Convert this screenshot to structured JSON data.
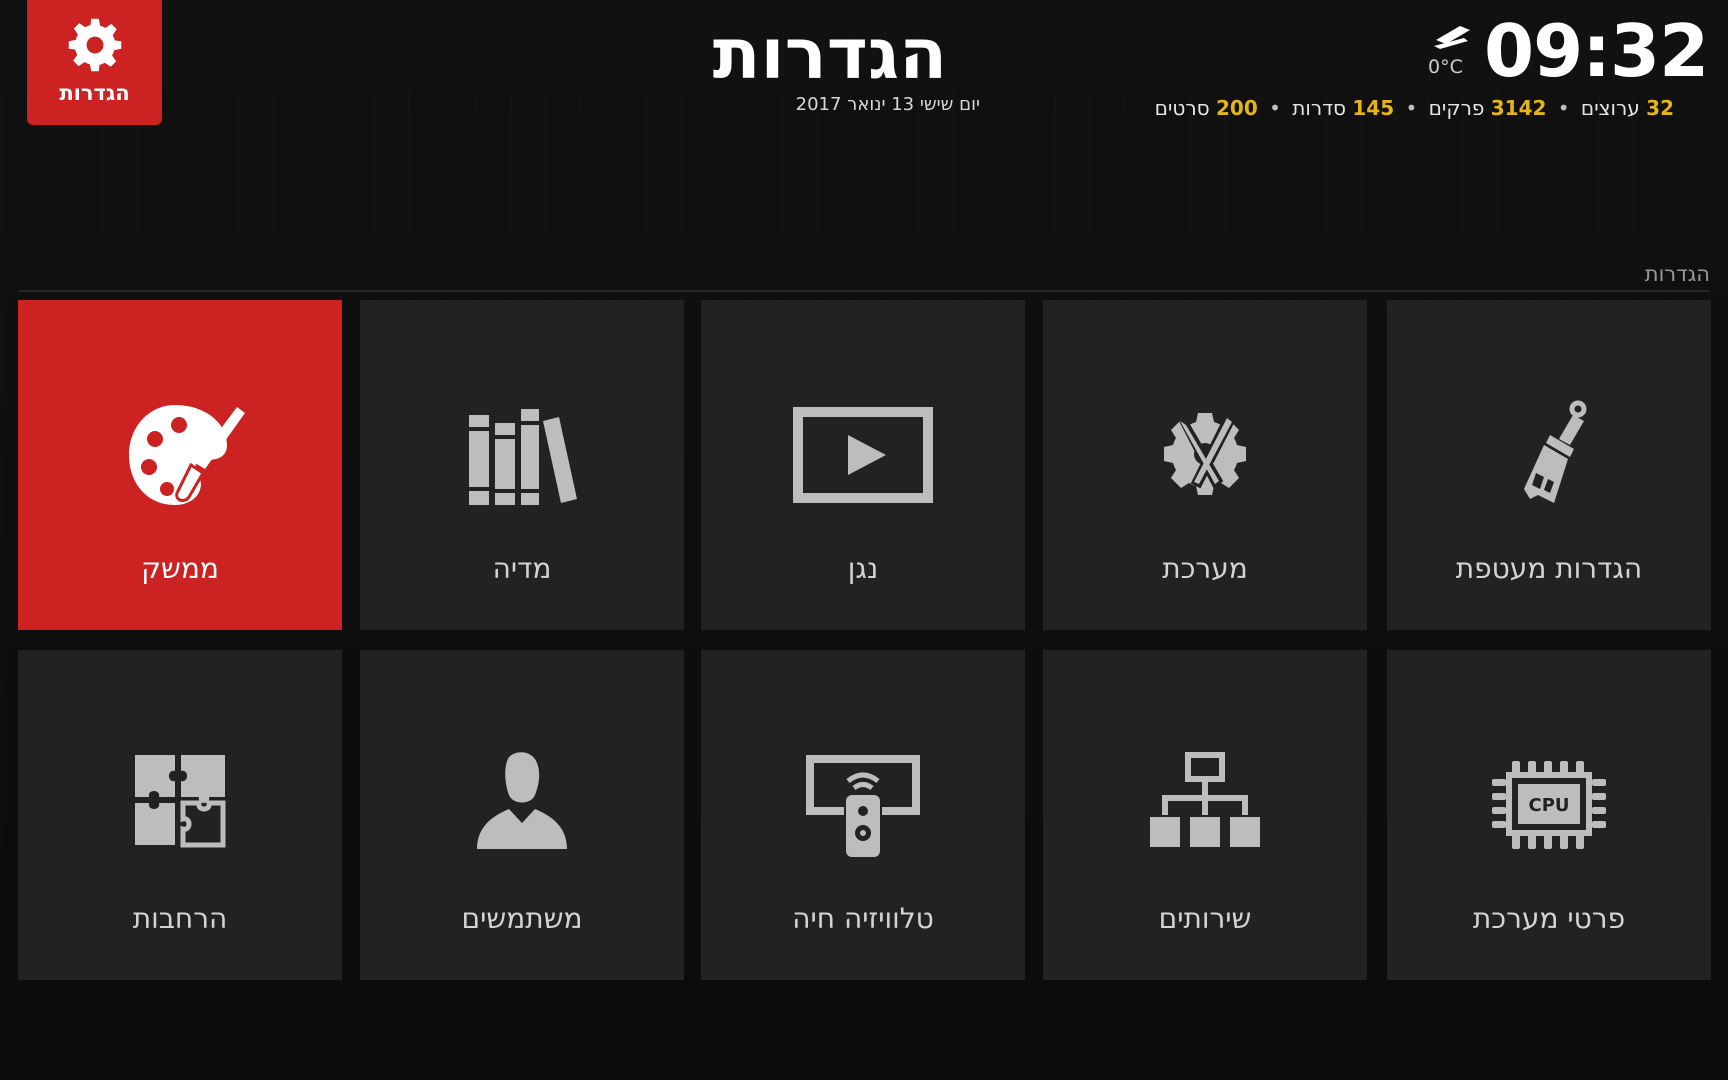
{
  "header": {
    "badge_label": "הגדרות",
    "badge_icon": "gear-icon",
    "title": "הגדרות",
    "date": "יום שישי 13 ינואר 2017",
    "time": "09:32",
    "weather_icon": "cloud-icon",
    "temperature": "0°C",
    "stats": [
      {
        "count": "32",
        "label": "ערוצים"
      },
      {
        "count": "3142",
        "label": "פרקים"
      },
      {
        "count": "145",
        "label": "סדרות"
      },
      {
        "count": "200",
        "label": "סרטים"
      }
    ]
  },
  "section": {
    "label": "הגדרות"
  },
  "tiles": [
    {
      "label": "הגדרות מעטפת",
      "icon": "paintbrush-icon"
    },
    {
      "label": "מערכת",
      "icon": "gear-tools-icon"
    },
    {
      "label": "נגן",
      "icon": "play-screen-icon"
    },
    {
      "label": "מדיה",
      "icon": "books-icon"
    },
    {
      "label": "ממשק",
      "icon": "palette-icon",
      "active": true
    },
    {
      "label": "פרטי מערכת",
      "icon": "cpu-icon"
    },
    {
      "label": "שירותים",
      "icon": "network-icon"
    },
    {
      "label": "טלוויזיה חיה",
      "icon": "tv-remote-icon"
    },
    {
      "label": "משתמשים",
      "icon": "user-icon"
    },
    {
      "label": "הרחבות",
      "icon": "puzzle-icon"
    }
  ],
  "colors": {
    "accent": "#cc2222",
    "highlight_numbers": "#e5b418",
    "tile_bg": "#222222",
    "background": "#111111"
  }
}
